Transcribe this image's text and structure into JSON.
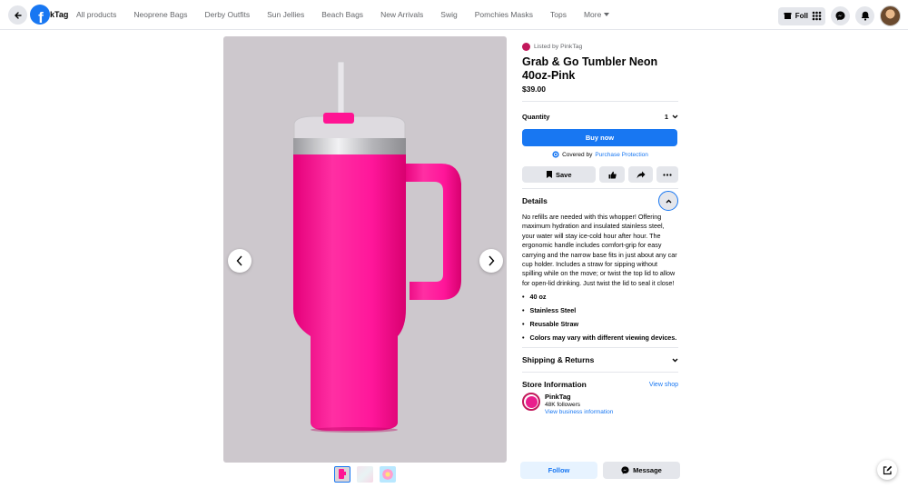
{
  "header": {
    "shop_name_partial": "kTag",
    "nav": [
      "All products",
      "Neoprene Bags",
      "Derby Outfits",
      "Sun Jellies",
      "Beach Bags",
      "New Arrivals",
      "Swig",
      "Pomchies Masks",
      "Tops"
    ],
    "more_label": "More",
    "follow_label": "Foll",
    "icons": [
      "back-arrow-icon",
      "facebook-icon",
      "shop-icon",
      "grid-icon",
      "messenger-icon",
      "bell-icon",
      "profile-avatar"
    ]
  },
  "product": {
    "listed_by": "Listed by PinkTag",
    "title": "Grab & Go Tumbler Neon 40oz-Pink",
    "price": "$39.00",
    "quantity_label": "Quantity",
    "quantity_value": "1",
    "buy_label": "Buy now",
    "covered_text": "Covered by",
    "covered_link": "Purchase Protection",
    "save_label": "Save"
  },
  "details": {
    "heading": "Details",
    "description": "No refills are needed with this whopper! Offering maximum hydration and insulated stainless steel, your water will stay ice-cold hour after hour. The ergonomic handle includes comfort-grip for easy carrying and the narrow base fits in just about any car cup holder. Includes a straw for sipping without spilling while on the move; or twist the top lid to allow for open-lid drinking. Just twist the lid to seal it close!",
    "bullets": [
      "40 oz",
      "Stainless Steel",
      "Reusable Straw",
      "Colors may vary with different viewing devices."
    ]
  },
  "shipping": {
    "heading": "Shipping & Returns"
  },
  "store": {
    "heading": "Store Information",
    "view_shop": "View shop",
    "name": "PinkTag",
    "followers": "48K followers",
    "business_link": "View business information",
    "follow_label": "Follow",
    "message_label": "Message"
  },
  "colors": {
    "accent": "#1877f2",
    "product_pink": "#ff1493",
    "background_photo": "#cdc8cd"
  }
}
